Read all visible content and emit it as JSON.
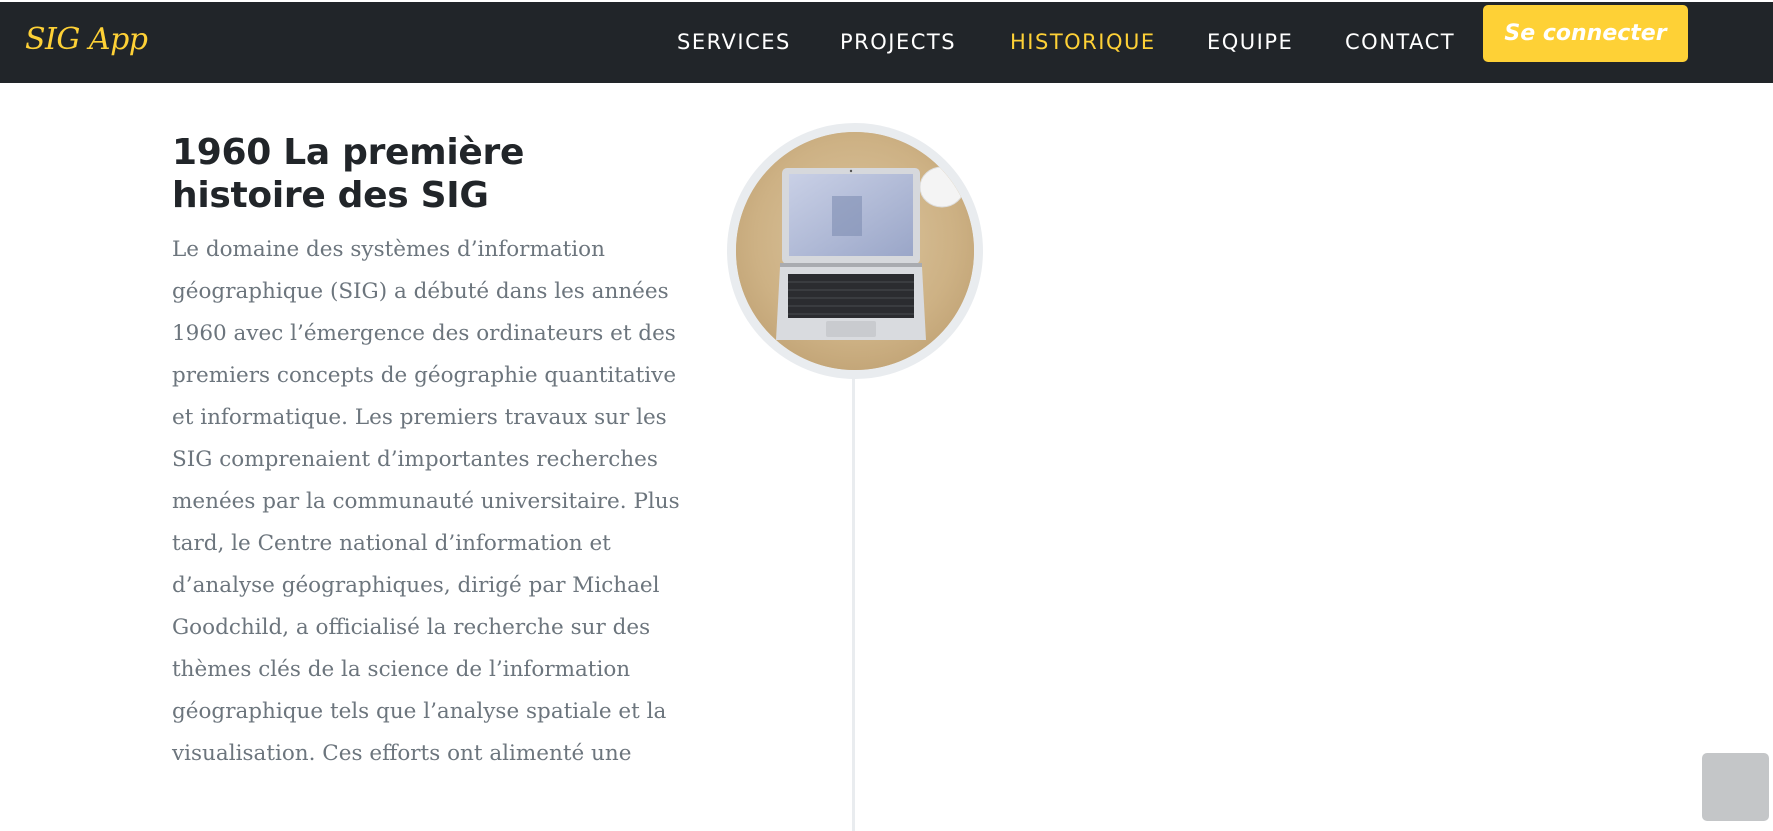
{
  "navbar": {
    "brand": "SIG App",
    "links": [
      {
        "label": "SERVICES",
        "active": false
      },
      {
        "label": "PROJECTS",
        "active": false
      },
      {
        "label": "HISTORIQUE",
        "active": true
      },
      {
        "label": "EQUIPE",
        "active": false
      },
      {
        "label": "CONTACT",
        "active": false
      }
    ],
    "login_label": "Se connecter"
  },
  "timeline": {
    "heading": "1960 La première histoire des SIG",
    "body": "Le domaine des systèmes d’information géographique (SIG) a débuté dans les années 1960 avec l’émergence des ordinateurs et des premiers concepts de géographie quantitative et informatique. Les premiers travaux sur les SIG comprenaient d’importantes recherches menées par la communauté universitaire. Plus tard, le Centre national d’information et d’analyse géographiques, dirigé par Michael Goodchild, a officialisé la recherche sur des thèmes clés de la science de l’information géographique tels que l’analyse spatiale et la visualisation. Ces efforts ont alimenté une"
  },
  "colors": {
    "navbar_bg": "#212529",
    "accent": "#fed136",
    "heading": "#212529",
    "body_text": "#6c757d",
    "timeline_line": "#e9ecef"
  },
  "icons": {
    "scroll_top": "chevron-up-icon",
    "timeline_image": "laptop-on-desk-photo"
  }
}
